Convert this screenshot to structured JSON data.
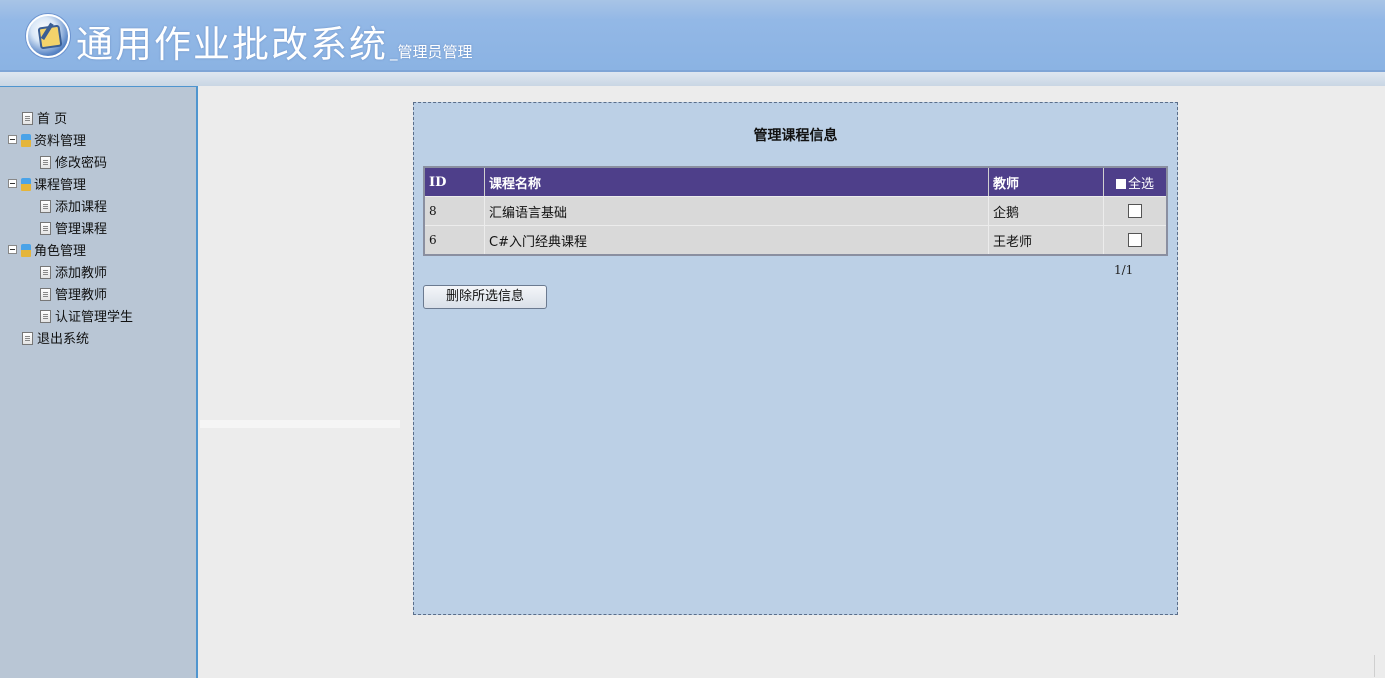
{
  "header": {
    "title": "通用作业批改系统",
    "subtitle": "_管理员管理"
  },
  "sidebar": {
    "items": [
      {
        "label": "首 页",
        "type": "page",
        "level": 0
      },
      {
        "label": "资料管理",
        "type": "group",
        "level": 0
      },
      {
        "label": "修改密码",
        "type": "page",
        "level": 1
      },
      {
        "label": "课程管理",
        "type": "group",
        "level": 0
      },
      {
        "label": "添加课程",
        "type": "page",
        "level": 1
      },
      {
        "label": "管理课程",
        "type": "page",
        "level": 1
      },
      {
        "label": "角色管理",
        "type": "group",
        "level": 0
      },
      {
        "label": "添加教师",
        "type": "page",
        "level": 1
      },
      {
        "label": "管理教师",
        "type": "page",
        "level": 1
      },
      {
        "label": "认证管理学生",
        "type": "page",
        "level": 1
      },
      {
        "label": "退出系统",
        "type": "page",
        "level": 0
      }
    ]
  },
  "main": {
    "title": "管理课程信息",
    "table": {
      "headers": {
        "id": "ID",
        "name": "课程名称",
        "teacher": "教师",
        "select_all": "全选"
      },
      "rows": [
        {
          "id": "8",
          "name": "汇编语言基础",
          "teacher": "企鹅",
          "checked": false
        },
        {
          "id": "6",
          "name": "C#入门经典课程",
          "teacher": "王老师",
          "checked": false
        }
      ]
    },
    "pager": "1/1",
    "delete_button": "删除所选信息"
  },
  "colors": {
    "header_bg": "#8bb3e3",
    "sidebar_bg": "#b9c6d5",
    "panel_bg": "#bcd0e6",
    "table_header_bg": "#4e3f8a",
    "table_row_bg": "#d9d9d9"
  }
}
